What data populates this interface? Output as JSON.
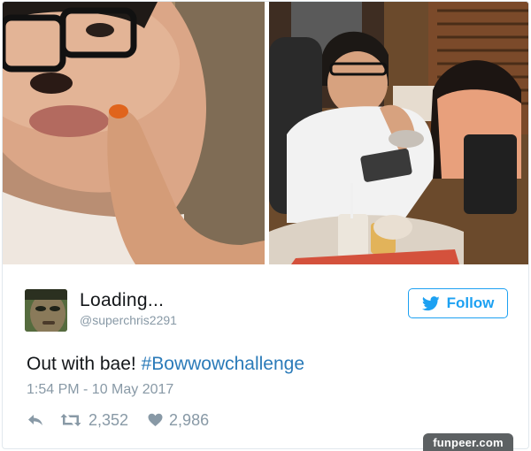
{
  "user": {
    "display_name": "Loading...",
    "handle": "@superchris2291"
  },
  "follow_button": {
    "label": "Follow",
    "icon": "twitter-bird-icon",
    "color": "#1da1f2"
  },
  "tweet": {
    "text": "Out with bae! ",
    "hashtag": "#Bowwowchallenge",
    "timestamp": "1:54 PM - 10 May 2017"
  },
  "actions": {
    "reply_icon": "reply-icon",
    "retweet_icon": "retweet-icon",
    "retweet_count": "2,352",
    "like_icon": "heart-icon",
    "like_count": "2,986"
  },
  "watermark": {
    "text": "funpeer.com"
  },
  "colors": {
    "link": "#2b7bb9",
    "muted": "#8899a6",
    "text": "#14171a"
  }
}
